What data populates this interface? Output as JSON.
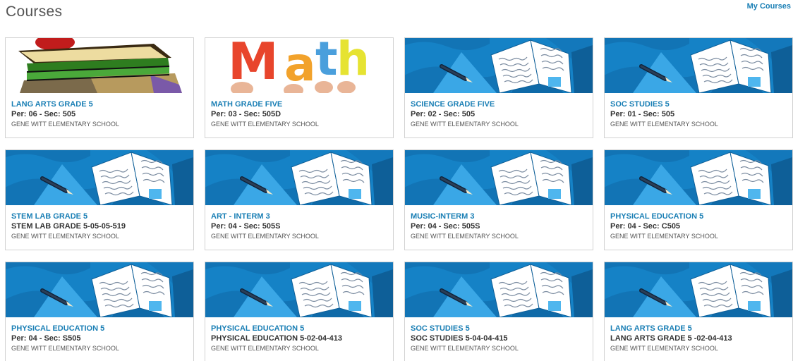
{
  "header": {
    "title": "Courses",
    "my_courses_link": "My Courses"
  },
  "courses": [
    {
      "title": "LANG ARTS GRADE 5",
      "section": "Per: 06 - Sec: 505",
      "school": "GENE WITT ELEMENTARY SCHOOL",
      "image": "books-stack"
    },
    {
      "title": "MATH GRADE FIVE",
      "section": "Per: 03 - Sec: 505D",
      "school": "GENE WITT ELEMENTARY SCHOOL",
      "image": "math-letters"
    },
    {
      "title": "SCIENCE GRADE FIVE",
      "section": "Per: 02 - Sec: 505",
      "school": "GENE WITT ELEMENTARY SCHOOL",
      "image": "default-book"
    },
    {
      "title": "SOC STUDIES 5",
      "section": "Per: 01 - Sec: 505",
      "school": "GENE WITT ELEMENTARY SCHOOL",
      "image": "default-book"
    },
    {
      "title": "STEM LAB GRADE 5",
      "section": "STEM LAB GRADE 5-05-05-519",
      "school": "GENE WITT ELEMENTARY SCHOOL",
      "image": "default-book"
    },
    {
      "title": "ART - INTERM 3",
      "section": "Per: 04 - Sec: 505S",
      "school": "GENE WITT ELEMENTARY SCHOOL",
      "image": "default-book"
    },
    {
      "title": "MUSIC-INTERM 3",
      "section": "Per: 04 - Sec: 505S",
      "school": "GENE WITT ELEMENTARY SCHOOL",
      "image": "default-book"
    },
    {
      "title": "PHYSICAL EDUCATION 5",
      "section": "Per: 04 - Sec: C505",
      "school": "GENE WITT ELEMENTARY SCHOOL",
      "image": "default-book"
    },
    {
      "title": "PHYSICAL EDUCATION 5",
      "section": "Per: 04 - Sec: S505",
      "school": "GENE WITT ELEMENTARY SCHOOL",
      "image": "default-book"
    },
    {
      "title": "PHYSICAL EDUCATION 5",
      "section": "PHYSICAL EDUCATION 5-02-04-413",
      "school": "GENE WITT ELEMENTARY SCHOOL",
      "image": "default-book"
    },
    {
      "title": "SOC STUDIES 5",
      "section": "SOC STUDIES 5-04-04-415",
      "school": "GENE WITT ELEMENTARY SCHOOL",
      "image": "default-book"
    },
    {
      "title": "LANG ARTS GRADE 5",
      "section": "LANG ARTS GRADE 5 -02-04-413",
      "school": "GENE WITT ELEMENTARY SCHOOL",
      "image": "default-book"
    }
  ],
  "colors": {
    "link": "#1a7fb5",
    "banner_blue": "#1480c4",
    "banner_light": "#3aa3e0"
  },
  "math_image_text": "Math"
}
